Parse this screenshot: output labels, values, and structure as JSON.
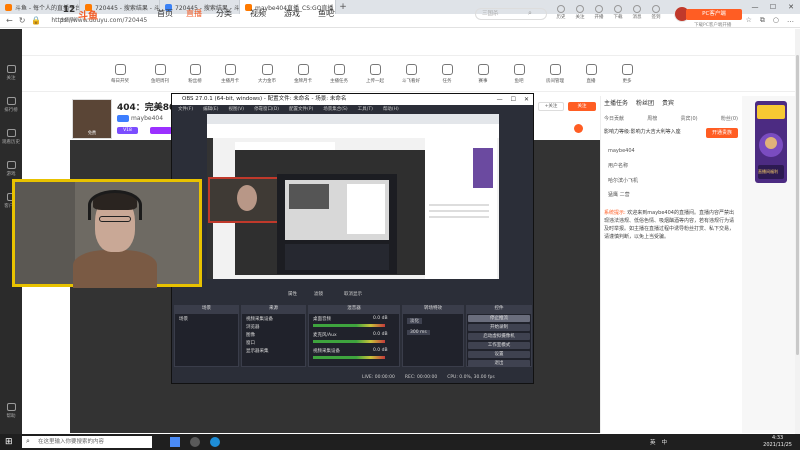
{
  "browser": {
    "tabs": [
      {
        "title": "斗鱼 - 每个人的直播平台",
        "favicon_color": "#ff7a00"
      },
      {
        "title": "720445 - 搜索结果 - 斗鱼直播",
        "favicon_color": "#ff7a00"
      },
      {
        "title": "720445 - 搜索结果 - 斗鱼直播",
        "favicon_color": "#3b82f6"
      },
      {
        "title": "maybe404直播_CS:GO直播_斗鱼",
        "favicon_color": "#ff7a00"
      }
    ],
    "new_tab": "+",
    "url": "https://www.douyu.com/720445"
  },
  "left_sidebar": [
    "关注",
    "排行榜",
    "观看历史",
    "游戏",
    "客户端",
    "帮助"
  ],
  "header": {
    "logo": "斗鱼",
    "nav": [
      "首页",
      "直播",
      "分类",
      "视频",
      "游戏",
      "鱼吧"
    ],
    "active_nav": "直播",
    "search_placeholder": "三国杀",
    "icons": [
      "历史",
      "关注",
      "开播",
      "下载",
      "消息",
      "签到",
      "任务"
    ]
  },
  "category_bar": {
    "rank_number": "12",
    "rank_label": "主播排行",
    "items": [
      "每日开奖",
      "鱼吧周刊",
      "粉丝榜",
      "主播月卡",
      "大力金币",
      "金牌月卡",
      "主播任务",
      "上传一起",
      "斗飞看好",
      "任务",
      "赛事",
      "鱼吧",
      "房间管理",
      "直播",
      "更多"
    ],
    "pc_button": "PC客户端",
    "pc_sub": "下载PC客户端开播"
  },
  "room": {
    "title": "404：完美800分",
    "host": "maybe404",
    "vip_badge": "V18",
    "follow": "关注",
    "follow_count": "+关注",
    "avatar_label": "免费"
  },
  "obs": {
    "title": "OBS 27.0.1 (64-bit, windows) - 配置文件: 未命名 - 场景: 未命名",
    "menu": [
      "文件(F)",
      "编辑(E)",
      "视图(V)",
      "停靠窗口(D)",
      "配置文件(P)",
      "场景集合(S)",
      "工具(T)",
      "帮助(H)"
    ],
    "toolbar": [
      "属性",
      "滤镜",
      "取消显示"
    ],
    "docks": [
      "场景",
      "来源",
      "混音器",
      "转场特效",
      "控件"
    ],
    "scene": "场景",
    "sources": [
      "视频采集设备",
      "浏览器",
      "图像",
      "窗口",
      "显示器采集"
    ],
    "mixer": [
      "桌面音频",
      "麦克风/Aux",
      "视频采集设备"
    ],
    "mixer_db": [
      "0.0 dB",
      "0.0 dB",
      "0.0 dB"
    ],
    "transition": "淡化",
    "transition_duration": "300 ms",
    "controls": [
      "停止推流",
      "开始录制",
      "启动虚拟摄像机",
      "工作室模式",
      "设置",
      "退出"
    ],
    "status": [
      "LIVE: 00:00:00",
      "REC: 00:00:00",
      "CPU: 0.0%, 30.00 fps"
    ]
  },
  "chat": {
    "tabs": [
      "主播任务",
      "粉丝团",
      "贵宾"
    ],
    "rank_row": [
      "今日贡献",
      "周榜",
      "贵宾(0)",
      "粉丝(0)"
    ],
    "contribution_text": "影响力等级:影响力大吉大利等入座",
    "contribution_button": "开通贵族",
    "lines": [
      "maybe404",
      "用户名称",
      "哈尔滨小飞机",
      "猛鹰 二营"
    ],
    "system_label": "系统提示:",
    "system_message": "欢迎来到maybe404的直播间。直播内容严禁出现违法违规、低俗色情、吸烟酗酒等内容，若有违规行为请及时举报。如主播在直播过程中诱导粉丝打赏、私下交易，请谨慎判断，以免上当受骗。"
  },
  "gift_banner": "直播间福利",
  "taskbar": {
    "search_placeholder": "在这里输入你要搜索的内容",
    "tray": [
      "英",
      "中"
    ],
    "time": "4:33",
    "date": "2021/11/25"
  }
}
